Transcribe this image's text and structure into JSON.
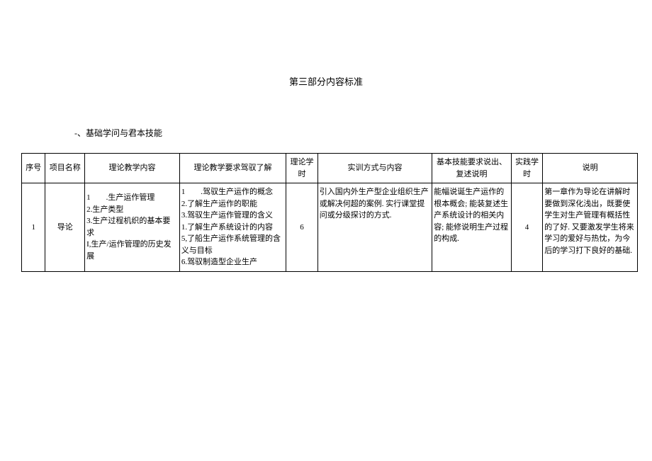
{
  "title": "第三部分内容标准",
  "section_heading": "-、基础学问与君本技能",
  "table": {
    "headers": {
      "seq": "序号",
      "name": "项目名称",
      "content": "理论教学内容",
      "require": "理论教学要求驾驭了解",
      "hours1": "理论学时",
      "practice": "实训方式与内容",
      "skill": "基本技能要求说出、复述说明",
      "hours2": "实践学时",
      "note": "说明"
    },
    "rows": [
      {
        "seq": "1",
        "name": "导论",
        "content": "1　　.生产运作管理\n2.生产类型\n3.生产过程机织的基本要求\nI,生产/运作管理的历史发展",
        "require": "1　　.驾驭生产运作的概念\n2.了解生产运作的职能\n3.驾驭生产运作管理的含义\n1.了解生产系统设计的内容\n5,了船生产运作系统管理的含义与目标\n6.驾驭制造型企业生产",
        "hours1": "6",
        "practice": "引入国内外生产型企业组织生产或解决何超的案例. 实行课堂提问或分级探讨的方式.",
        "skill": "能幅说诞生产运作的根本概会; 能装复述生产系统设计的相关内容; 能修说明生产过程的构成.",
        "hours2": "4",
        "note": "第一章作为导论在讲解时要做到深化浅出，既要使学生对生产管理有概括性的了好. 又要激发学生将来学习的爱好与热忱，为今后的学习打下良好的基础."
      }
    ]
  }
}
